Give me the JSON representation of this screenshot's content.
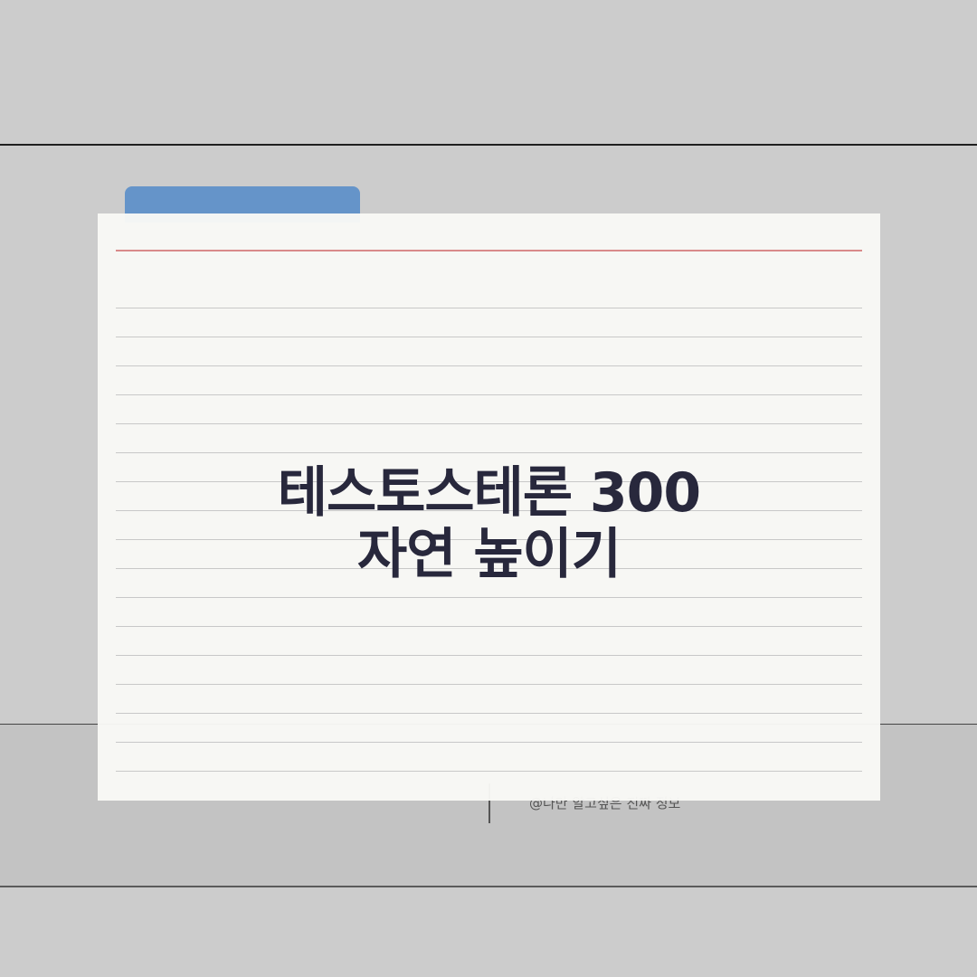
{
  "card": {
    "title_line1": "테스토스테론 300",
    "title_line2": "자연 높이기"
  },
  "footer": {
    "credit": "@나만 알고싶은 진짜 정보"
  },
  "colors": {
    "background": "#cccccc",
    "tab": "#6594c9",
    "card": "#f9f9f6",
    "title": "#28283c",
    "red_rule": "#d98a8a"
  }
}
